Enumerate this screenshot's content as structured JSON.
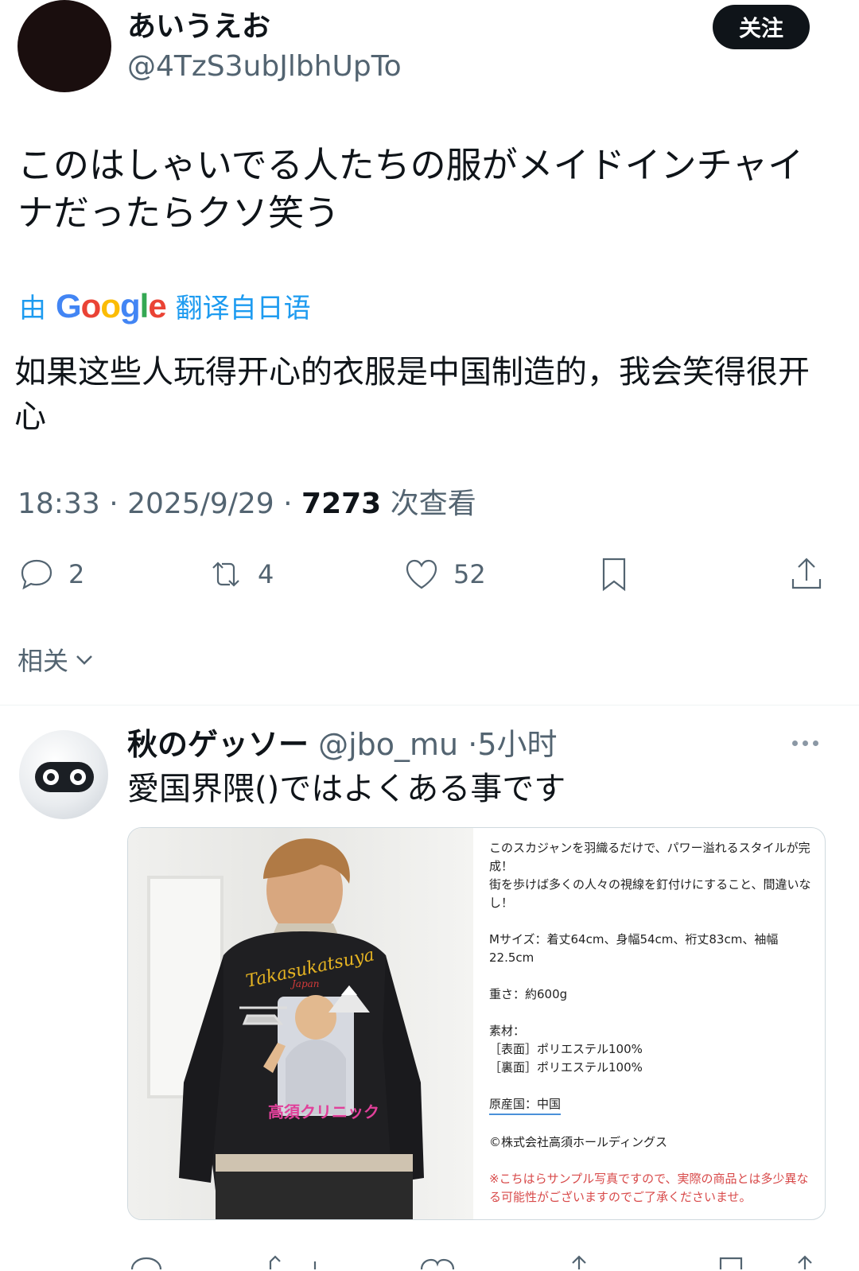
{
  "tweet": {
    "display_name": "あいうえお",
    "handle": "@4TzS3ubJlbhUpTo",
    "follow_label": "关注",
    "text": "このはしゃいでる人たちの服がメイドインチャイナだったらクソ笑う",
    "translation": {
      "prefix": "由",
      "provider": "Google",
      "suffix": "翻译自日语",
      "text": "如果这些人玩得开心的衣服是中国制造的，我会笑得很开心"
    },
    "time": "18:33",
    "date": "2025/9/29",
    "views": "7273",
    "views_label": "次查看",
    "actions": {
      "replies": "2",
      "retweets": "4",
      "likes": "52"
    },
    "related_label": "相关"
  },
  "reply": {
    "display_name": "秋のゲッソー",
    "handle": "@jbo_mu",
    "time": "5小时",
    "text": "愛国界隈()ではよくある事です",
    "media": {
      "jacket_script_text": "Takasukatsuya",
      "jacket_sub_text": "Japan",
      "jacket_logo_text": "高須クリニック",
      "panel_lines": [
        "このスカジャンを羽織るだけで、パワー溢れるスタイルが完成！",
        "街を歩けば多くの人々の視線を釘付けにすること、間違いなし！",
        "",
        "Mサイズ：着丈64cm、身幅54cm、裄丈83cm、袖幅22.5cm",
        "",
        "重さ：約600g",
        "",
        "素材：",
        "［表面］ポリエステル100%",
        "［裏面］ポリエステル100%",
        "",
        "原産国：中国",
        "",
        "©株式会社高須ホールディングス",
        ""
      ],
      "note": "※こちはらサンプル写真ですので、実際の商品とは多少異なる可能性がございますのでご了承くださいませ。"
    }
  },
  "colors": {
    "accent": "#1d9bf0",
    "text": "#0f1419",
    "muted": "#536471",
    "note_red": "#d84a4a"
  }
}
